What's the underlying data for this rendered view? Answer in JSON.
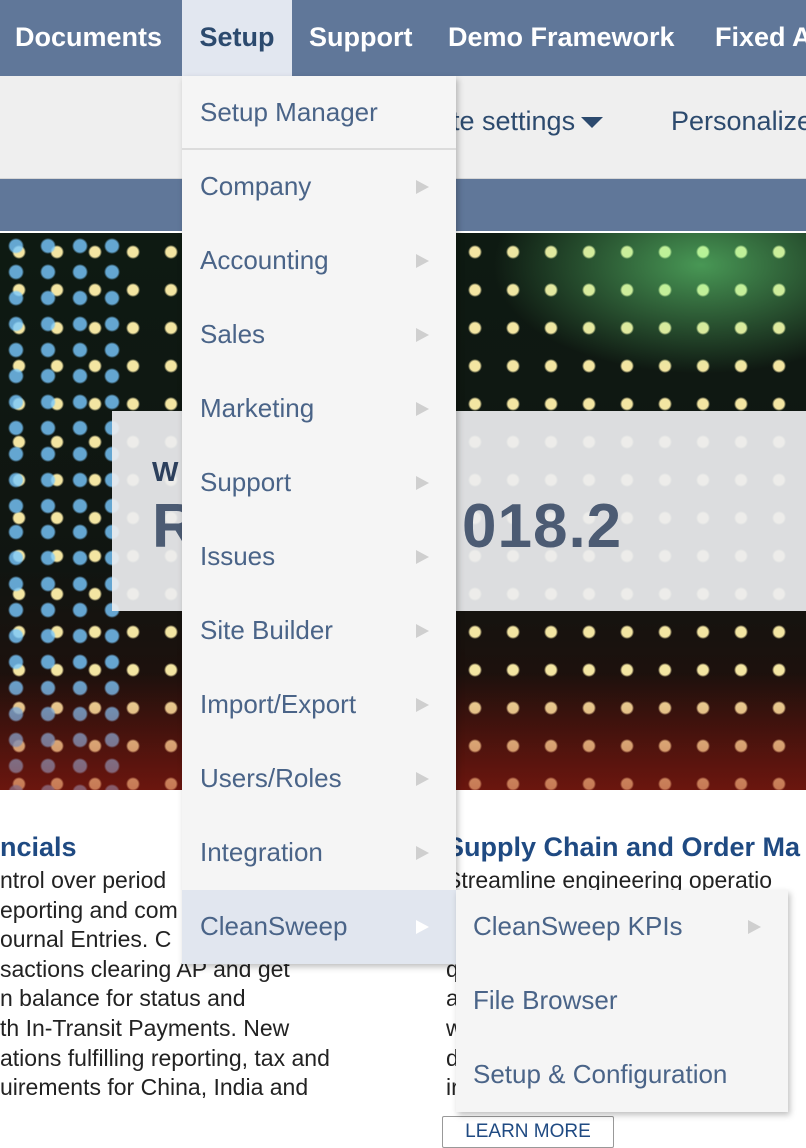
{
  "topnav": {
    "items": [
      "Documents",
      "Setup",
      "Support",
      "Demo Framework",
      "Fixed A"
    ]
  },
  "subbar": {
    "site_settings": "te settings",
    "personalize": "Personalize"
  },
  "hero": {
    "welcome_fragment": "W",
    "release_fragment_left": "R",
    "release_fragment_right": "018.2"
  },
  "menu": {
    "header": "Setup Manager",
    "items": [
      "Company",
      "Accounting",
      "Sales",
      "Marketing",
      "Support",
      "Issues",
      "Site Builder",
      "Import/Export",
      "Users/Roles",
      "Integration",
      "CleanSweep"
    ],
    "highlighted": "CleanSweep"
  },
  "submenu": {
    "items": [
      "CleanSweep KPIs",
      "File Browser",
      "Setup & Configuration"
    ]
  },
  "articles": {
    "left": {
      "title": "ncials",
      "lines": [
        "ntrol over period",
        "eporting and com",
        "ournal Entries. C",
        "sactions clearing AP and get",
        "n balance for status and",
        "th In-Transit Payments. New",
        "ations fulfilling reporting, tax and",
        "uirements for China, India and"
      ]
    },
    "right": {
      "title": "Supply Chain and Order Ma",
      "lines": [
        "Streamline engineering operatio",
        "",
        "",
        "q",
        "a",
        "w",
        "d",
        "ir"
      ],
      "learn_more": "LEARN MORE"
    }
  },
  "colors": {
    "nav_bg": "#607799",
    "menu_bg": "#f5f5f5",
    "highlight": "#e1e6ef",
    "link": "#1f4a82"
  }
}
